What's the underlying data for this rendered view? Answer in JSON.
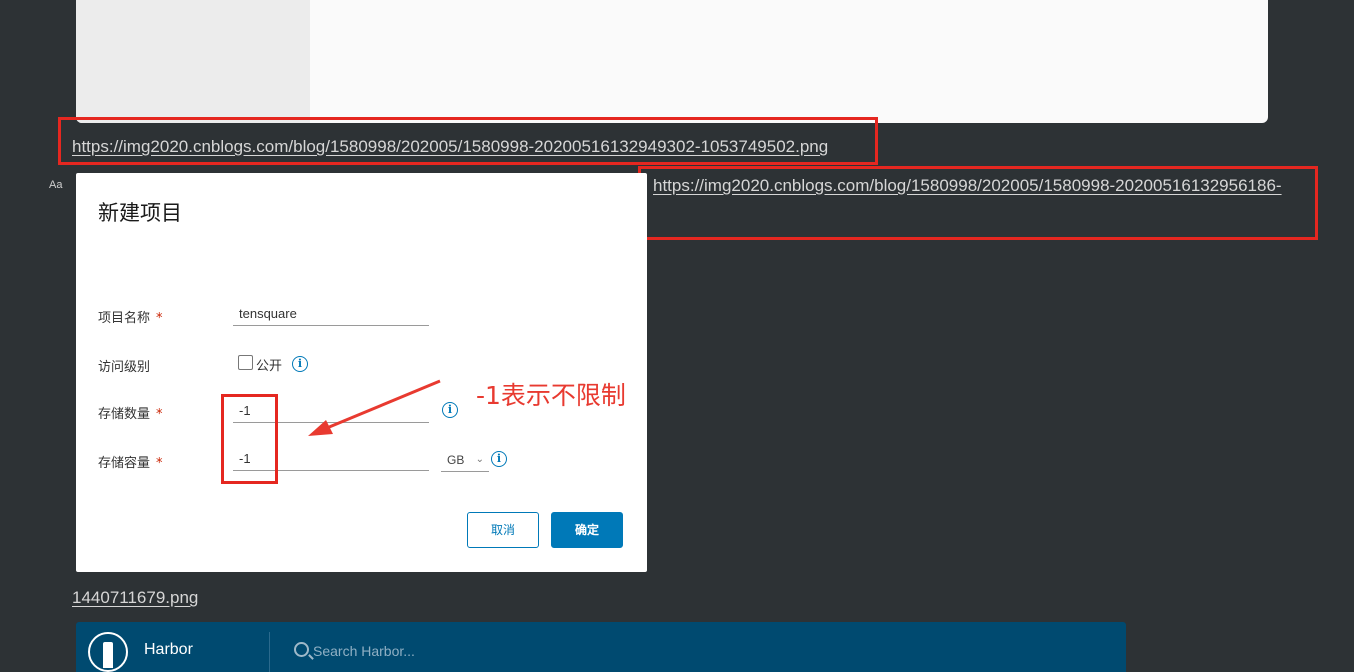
{
  "links": {
    "link1": "https://img2020.cnblogs.com/blog/1580998/202005/1580998-20200516132949302-1053749502.png",
    "link2": "https://img2020.cnblogs.com/blog/1580998/202005/1580998-20200516132956186-",
    "link3": "1440711679.png"
  },
  "editor": {
    "font_toggle": "Aa"
  },
  "dialog": {
    "title": "新建项目",
    "fields": {
      "name_label": "项目名称",
      "name_value": "tensquare",
      "access_label": "访问级别",
      "public_label": "公开",
      "count_label": "存储数量",
      "count_value": "-1",
      "capacity_label": "存储容量",
      "capacity_value": "-1",
      "unit_selected": "GB",
      "required_mark": "*",
      "info_glyph": "i"
    },
    "buttons": {
      "cancel": "取消",
      "ok": "确定"
    }
  },
  "annotation": {
    "text": "-1表示不限制",
    "color": "#e83a30"
  },
  "harbor": {
    "brand": "Harbor",
    "search_placeholder": "Search Harbor..."
  },
  "colors": {
    "accent": "#0079b8",
    "highlight_red": "#e52720",
    "harbor_bar": "#004a70"
  }
}
